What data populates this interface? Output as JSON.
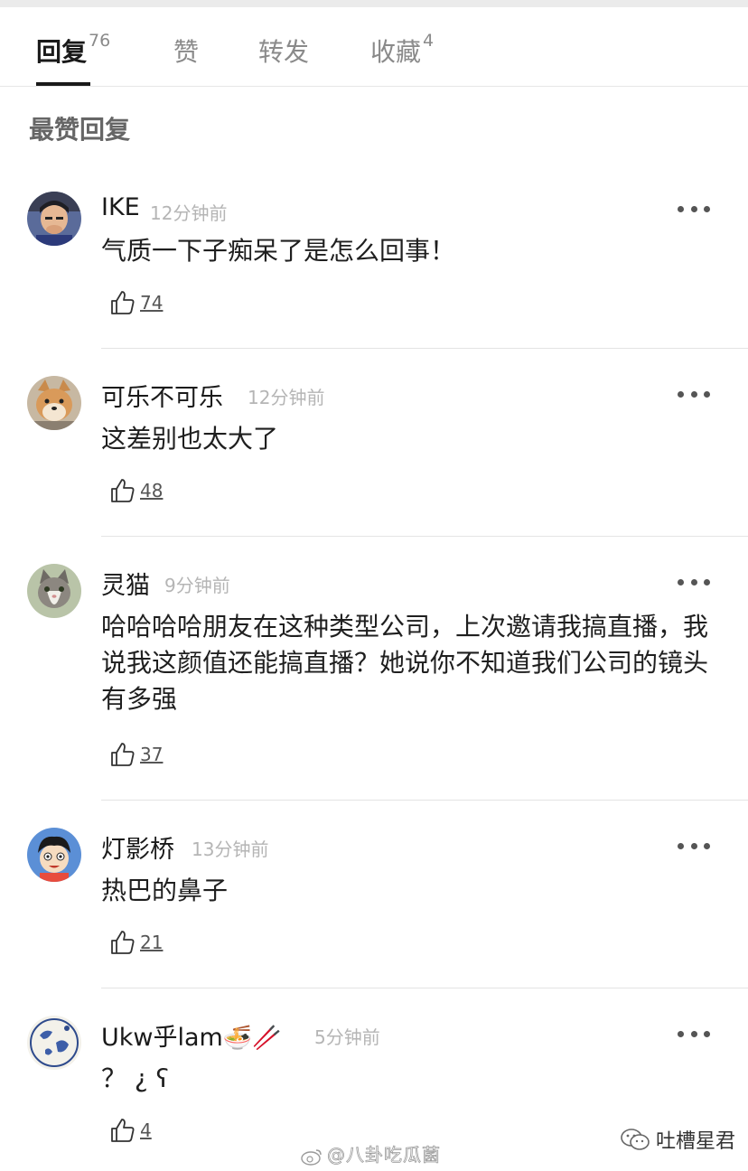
{
  "tabs": [
    {
      "label": "回复",
      "count": "76",
      "active": true
    },
    {
      "label": "赞",
      "count": ""
    },
    {
      "label": "转发",
      "count": ""
    },
    {
      "label": "收藏",
      "count": "4"
    }
  ],
  "section_title": "最赞回复",
  "comments": [
    {
      "user": "IKE",
      "time": "12分钟前",
      "text": "气质一下子痴呆了是怎么回事！",
      "likes": "74",
      "avatar_icon": "man-avatar"
    },
    {
      "user": "可乐不可乐",
      "time": "12分钟前",
      "text": "这差别也太大了",
      "likes": "48",
      "avatar_icon": "shiba-dog-avatar"
    },
    {
      "user": "灵猫",
      "time": "9分钟前",
      "text": "哈哈哈哈朋友在这种类型公司，上次邀请我搞直播，我说我这颜值还能搞直播？她说你不知道我们公司的镜头有多强",
      "likes": "37",
      "avatar_icon": "cat-avatar"
    },
    {
      "user": "灯影桥",
      "time": "13分钟前",
      "text": "热巴的鼻子",
      "likes": "21",
      "avatar_icon": "cartoon-boy-avatar"
    },
    {
      "user": "Ukw乎lam",
      "emoji": "🍜🥢",
      "time": "5分钟前",
      "text": "？ ¿ ʕ",
      "likes": "4",
      "avatar_icon": "globe-avatar"
    }
  ],
  "watermark": {
    "text": "@八卦吃瓜菌",
    "icon": "weibo-icon"
  },
  "corner_logo": {
    "text": "吐槽星君",
    "icon": "wechat-icon"
  },
  "colors": {
    "text_primary": "#1a1a1a",
    "text_secondary": "#8a8a8a",
    "time": "#b5b5b5",
    "divider": "#e4e4e4"
  }
}
